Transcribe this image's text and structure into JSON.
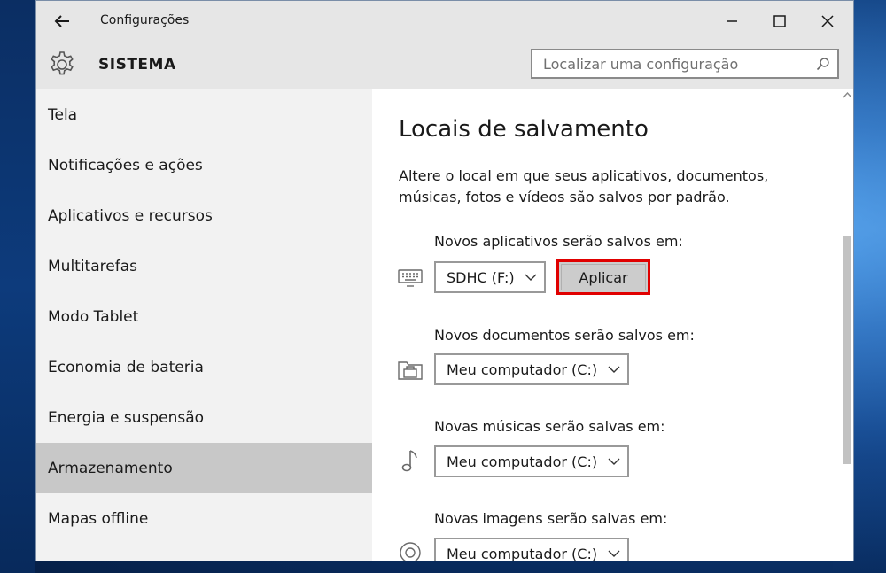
{
  "window": {
    "title": "Configurações",
    "controls": {
      "minimize": "minimize-icon",
      "maximize": "maximize-icon",
      "close": "close-icon"
    }
  },
  "header": {
    "section_title": "SISTEMA",
    "search_placeholder": "Localizar uma configuração"
  },
  "sidebar": {
    "items": [
      {
        "label": "Tela",
        "active": false
      },
      {
        "label": "Notificações e ações",
        "active": false
      },
      {
        "label": "Aplicativos e recursos",
        "active": false
      },
      {
        "label": "Multitarefas",
        "active": false
      },
      {
        "label": "Modo Tablet",
        "active": false
      },
      {
        "label": "Economia de bateria",
        "active": false
      },
      {
        "label": "Energia e suspensão",
        "active": false
      },
      {
        "label": "Armazenamento",
        "active": true
      },
      {
        "label": "Mapas offline",
        "active": false
      }
    ]
  },
  "main": {
    "title": "Locais de salvamento",
    "description": "Altere o local em que seus aplicativos, documentos, músicas, fotos e vídeos são salvos por padrão.",
    "groups": [
      {
        "label": "Novos aplicativos serão salvos em:",
        "icon": "keyboard-icon",
        "selected": "SDHC (F:)"
      },
      {
        "label": "Novos documentos serão salvos em:",
        "icon": "folder-drive-icon",
        "selected": "Meu computador (C:)"
      },
      {
        "label": "Novas músicas serão salvas em:",
        "icon": "music-note-icon",
        "selected": "Meu computador (C:)"
      },
      {
        "label": "Novas imagens serão salvas em:",
        "icon": "camera-icon",
        "selected": "Meu computador (C:)"
      }
    ],
    "apply_label": "Aplicar"
  },
  "colors": {
    "highlight_border": "#e00000",
    "active_nav": "#c8c8c8"
  }
}
